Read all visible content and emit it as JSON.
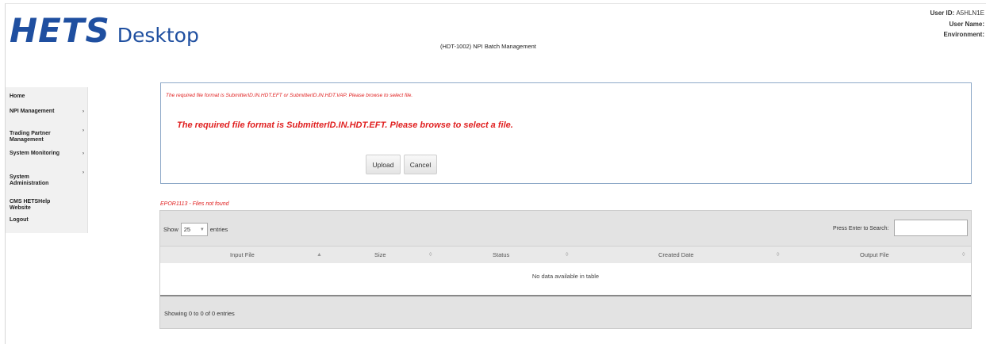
{
  "header": {
    "logo_main": "HETS",
    "logo_sub": "Desktop",
    "page_heading": "(HDT-1002) NPI Batch Management",
    "user_id_label": "User ID:",
    "user_id_value": "A5HLN1E",
    "user_name_label": "User Name:",
    "environment_label": "Environment:"
  },
  "sidebar": {
    "items": [
      {
        "label": "Home"
      },
      {
        "label": "NPI Management"
      },
      {
        "label": "Trading Partner\nManagement"
      },
      {
        "label": "System Monitoring"
      },
      {
        "label": "System\nAdministration"
      },
      {
        "label": "CMS HETSHelp\nWebsite"
      },
      {
        "label": "Logout"
      }
    ],
    "arrow_glyph": "›"
  },
  "upload_panel": {
    "message_small": "The required file format is SubmitterID.IN.HDT.EFT or SubmitterID.IN.HDT.VAP. Please browse to select file.",
    "message_large": "The required file format is SubmitterID.IN.HDT.EFT. Please browse to select a file.",
    "upload_button": "Upload",
    "cancel_button": "Cancel"
  },
  "error_code": "EPOR1113 - Files not found",
  "table": {
    "show_label": "Show",
    "entries_value": "25",
    "entries_label": "entries",
    "search_label": "Press Enter to Search:",
    "columns": [
      {
        "label": "Input File",
        "sort": "▲"
      },
      {
        "label": "Size",
        "sort": "◊"
      },
      {
        "label": "Status",
        "sort": "◊"
      },
      {
        "label": "Created Date",
        "sort": "◊"
      },
      {
        "label": "Output File",
        "sort": "◊"
      }
    ],
    "empty_message": "No data available in table",
    "info": "Showing 0 to 0 of 0 entries"
  },
  "colors": {
    "brand": "#1f4fa0",
    "error": "#e02020",
    "panel_border": "#8ea9c8"
  }
}
